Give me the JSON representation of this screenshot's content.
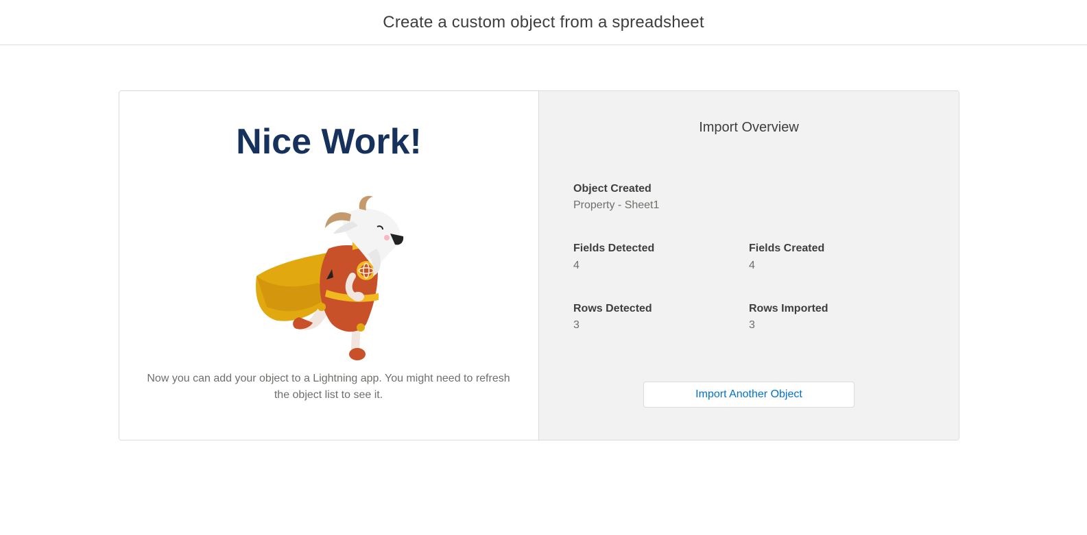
{
  "header": {
    "title": "Create a custom object from a spreadsheet"
  },
  "left": {
    "headline": "Nice Work!",
    "mascot_icon": "superhero-goat-mascot",
    "message": "Now you can add your object to a Lightning app. You might need to refresh the object list to see it."
  },
  "overview": {
    "title": "Import Overview",
    "object_created_label": "Object Created",
    "object_created_value": "Property - Sheet1",
    "fields_detected_label": "Fields Detected",
    "fields_detected_value": "4",
    "fields_created_label": "Fields Created",
    "fields_created_value": "4",
    "rows_detected_label": "Rows Detected",
    "rows_detected_value": "3",
    "rows_imported_label": "Rows Imported",
    "rows_imported_value": "3",
    "button_label": "Import Another Object"
  },
  "colors": {
    "headline": "#16325c",
    "link": "#0070d2",
    "panel_bg": "#f3f2f2"
  }
}
